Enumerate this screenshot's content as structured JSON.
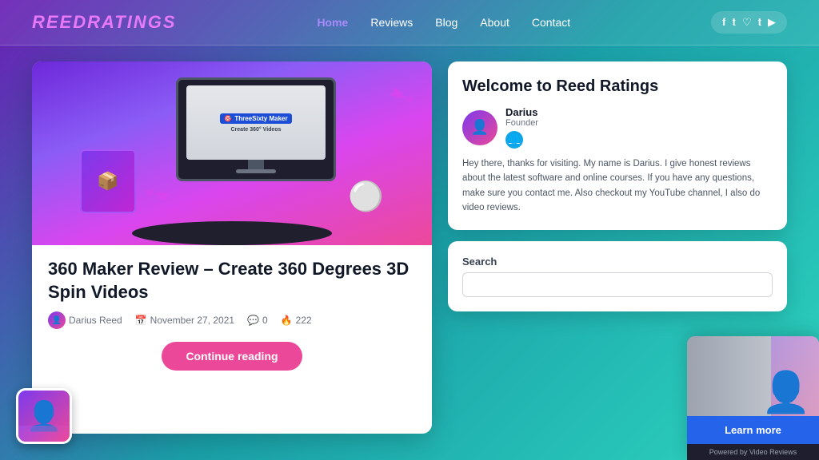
{
  "header": {
    "logo": "ReedRatings",
    "nav": {
      "items": [
        {
          "label": "Home",
          "active": true
        },
        {
          "label": "Reviews"
        },
        {
          "label": "Blog"
        },
        {
          "label": "About"
        },
        {
          "label": "Contact"
        }
      ]
    },
    "social": [
      "f",
      "t",
      "p",
      "t",
      "yt"
    ]
  },
  "article": {
    "title": "360 Maker Review – Create 360 Degrees 3D Spin Videos",
    "author": "Darius Reed",
    "date": "November 27, 2021",
    "comments": "0",
    "likes": "222",
    "continue_label": "Continue reading"
  },
  "sidebar": {
    "welcome_title": "Welcome to Reed Ratings",
    "author_name": "Darius",
    "author_role": "Founder",
    "description": "Hey there, thanks for visiting. My name is Darius. I give honest reviews about the latest software and online courses. If you have any questions, make sure you contact me. Also checkout my YouTube channel, I also do video reviews.",
    "search_label": "Search",
    "search_placeholder": ""
  },
  "video_popup": {
    "learn_label": "Learn more",
    "powered_label": "Powered by Video Reviews"
  }
}
